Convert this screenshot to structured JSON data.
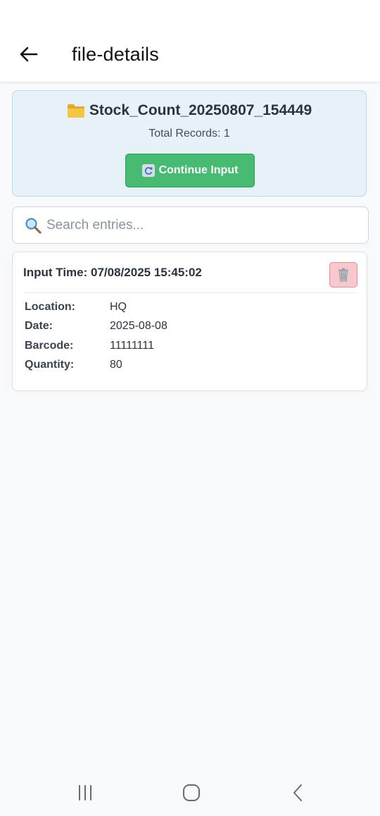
{
  "header": {
    "title": "file-details",
    "back_icon": "arrow-left-icon"
  },
  "file": {
    "icon": "folder-icon",
    "name": "Stock_Count_20250807_154449",
    "total_records": "Total Records: 1",
    "continue_label": "Continue Input"
  },
  "search": {
    "placeholder": "Search entries...",
    "value": ""
  },
  "entries": [
    {
      "input_time": "Input Time: 07/08/2025 15:45:02",
      "fields": [
        {
          "label": "Location:",
          "value": "HQ"
        },
        {
          "label": "Date:",
          "value": "2025-08-08"
        },
        {
          "label": "Barcode:",
          "value": "11111111"
        },
        {
          "label": "Quantity:",
          "value": "80"
        }
      ]
    }
  ],
  "colors": {
    "accent_green": "#48bb72",
    "header_card_bg": "#e6f2f8",
    "delete_bg": "#f7c9cc"
  },
  "system_nav": [
    "recent-apps-icon",
    "home-icon",
    "back-icon"
  ]
}
